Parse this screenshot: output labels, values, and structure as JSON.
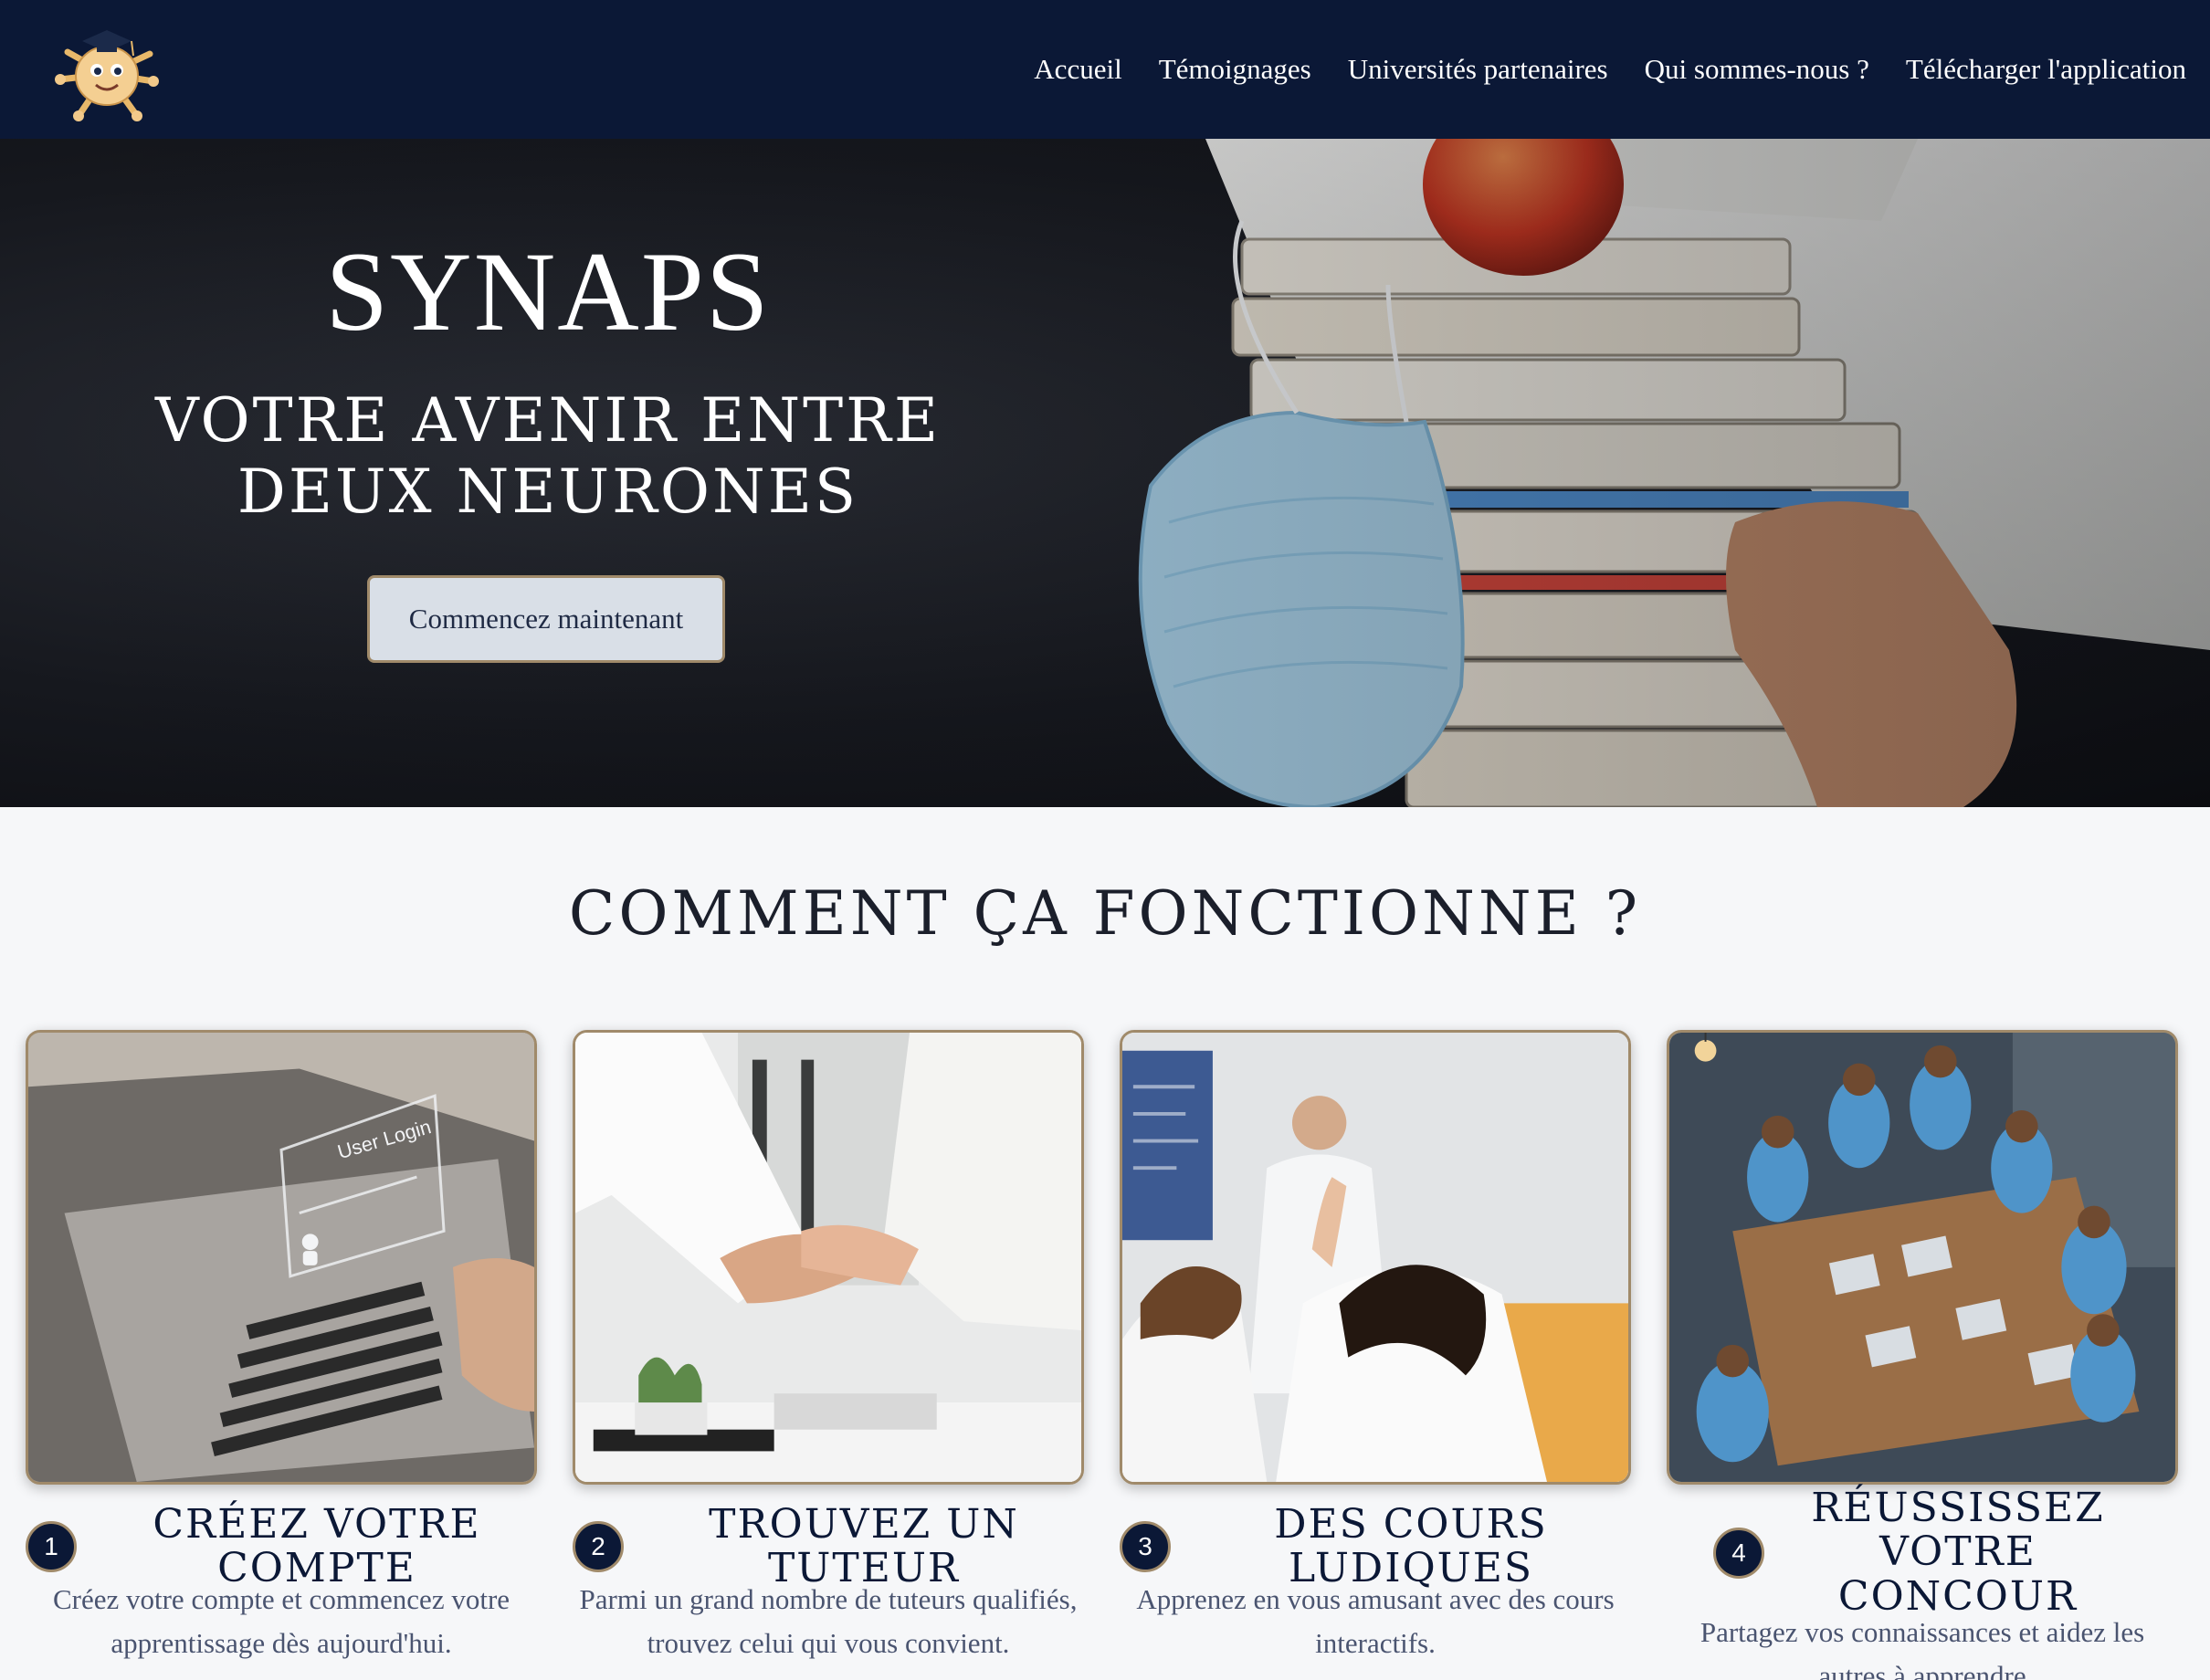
{
  "nav": {
    "logo_alt": "SYNAPS neuron mascot logo",
    "links": [
      "Accueil",
      "Témoignages",
      "Universités partenaires",
      "Qui sommes-nous ?",
      "Télécharger l'application"
    ]
  },
  "hero": {
    "title": "SYNAPS",
    "subtitle": "VOTRE AVENIR ENTRE DEUX NEURONES",
    "cta_label": "Commencez maintenant"
  },
  "how_it_works": {
    "title": "COMMENT ÇA FONCTIONNE ?",
    "steps": [
      {
        "number": "1",
        "title": "CRÉEZ VOTRE COMPTE",
        "description": "Créez votre compte et commencez votre apprentissage dès aujourd'hui."
      },
      {
        "number": "2",
        "title": "TROUVEZ UN TUTEUR",
        "description": "Parmi un grand nombre de tuteurs qualifiés, trouvez celui qui vous convient."
      },
      {
        "number": "3",
        "title": "DES COURS LUDIQUES",
        "description": "Apprenez en vous amusant avec des cours interactifs."
      },
      {
        "number": "4",
        "title": "RÉUSSISSEZ VOTRE CONCOUR",
        "description": "Partagez vos connaissances et aidez les autres à apprendre"
      }
    ]
  },
  "images": {
    "card1_screen_text": "User Login"
  },
  "colors": {
    "navy": "#0b1836",
    "gold_border": "#a08a6a",
    "page_bg": "#f6f7f9",
    "button_bg": "#d9dfe7"
  }
}
